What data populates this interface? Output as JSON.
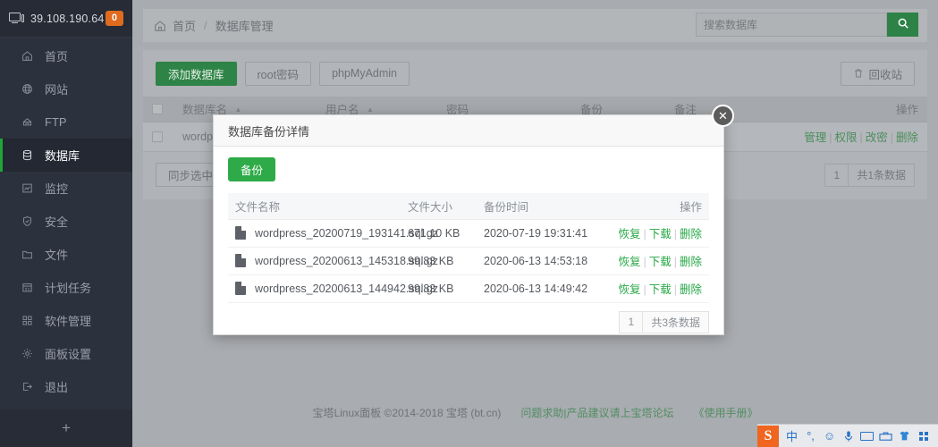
{
  "sidebar": {
    "ip": "39.108.190.64",
    "badge": "0",
    "items": [
      {
        "label": "首页",
        "icon": "home-icon"
      },
      {
        "label": "网站",
        "icon": "globe-icon"
      },
      {
        "label": "FTP",
        "icon": "ftp-icon"
      },
      {
        "label": "数据库",
        "icon": "database-icon"
      },
      {
        "label": "监控",
        "icon": "monitor-chart-icon"
      },
      {
        "label": "安全",
        "icon": "shield-icon"
      },
      {
        "label": "文件",
        "icon": "folder-icon"
      },
      {
        "label": "计划任务",
        "icon": "calendar-icon"
      },
      {
        "label": "软件管理",
        "icon": "apps-icon"
      },
      {
        "label": "面板设置",
        "icon": "gear-icon"
      },
      {
        "label": "退出",
        "icon": "logout-icon"
      }
    ],
    "active_index": 3,
    "add_label": "+"
  },
  "header": {
    "breadcrumb_home": "首页",
    "breadcrumb_sep": "/",
    "breadcrumb_current": "数据库管理",
    "search_placeholder": "搜索数据库",
    "search_value": ""
  },
  "toolbar": {
    "add_db": "添加数据库",
    "root_password": "root密码",
    "phpmyadmin": "phpMyAdmin",
    "recycle_bin": "回收站"
  },
  "table": {
    "columns": [
      "数据库名",
      "用户名",
      "密码",
      "备份",
      "备注",
      "操作"
    ],
    "rows": [
      {
        "name": "wordpr",
        "user": "",
        "password": "",
        "backup": "",
        "note": "",
        "actions": [
          "管理",
          "权限",
          "改密",
          "删除"
        ]
      }
    ],
    "sync_button": "同步选中",
    "page_number": "1",
    "total_text": "共1条数据"
  },
  "modal": {
    "title": "数据库备份详情",
    "backup_button": "备份",
    "close_icon": "✕",
    "columns": [
      "文件名称",
      "文件大小",
      "备份时间",
      "操作"
    ],
    "rows": [
      {
        "filename": "wordpress_20200719_193141.sql.gz",
        "size": "671.10 KB",
        "time": "2020-07-19 19:31:41",
        "actions": [
          "恢复",
          "下载",
          "删除"
        ]
      },
      {
        "filename": "wordpress_20200613_145318.sql.gz",
        "size": "99.83 KB",
        "time": "2020-06-13 14:53:18",
        "actions": [
          "恢复",
          "下载",
          "删除"
        ]
      },
      {
        "filename": "wordpress_20200613_144942.sql.gz",
        "size": "99.83 KB",
        "time": "2020-06-13 14:49:42",
        "actions": [
          "恢复",
          "下载",
          "删除"
        ]
      }
    ],
    "page_number": "1",
    "total_text": "共3条数据"
  },
  "footer": {
    "copyright": "宝塔Linux面板 ©2014-2018 宝塔 (bt.cn)",
    "link_forum": "问题求助|产品建议请上宝塔论坛",
    "link_manual": "《使用手册》"
  },
  "ime": {
    "logo": "S",
    "mode": "中",
    "punct": "°,",
    "emoji": "☺",
    "mic": "🎤",
    "keyboard": "keyboard-icon",
    "toolbox": "toolbox-icon",
    "skin": "shirt-icon",
    "grid": "grid-icon"
  },
  "colors": {
    "accent_green": "#2eab48",
    "sidebar_bg": "#2b313d",
    "badge_orange": "#df6b1f"
  }
}
